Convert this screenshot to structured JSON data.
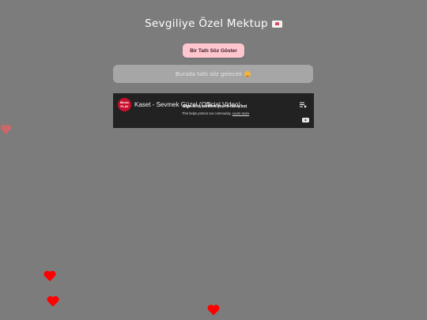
{
  "page": {
    "title": "Sevgiliye Özel Mektup",
    "title_icon": "love-letter-icon"
  },
  "sweet_button": {
    "label": "Bir Tatlı Söz Göster",
    "color": "#ffc6d0"
  },
  "message": {
    "text": "Burada tatlı söz gelecek",
    "icon": "smiling-face-icon"
  },
  "video": {
    "channel_logo_line1": "Music",
    "channel_logo_line2": "PLAY",
    "title": "Kaset - Sevmek Güzel (Official Video)",
    "bot_notice": "Sign in to confirm you're not a bot",
    "bot_sub": "This helps protect our community.",
    "learn_more": "Learn more"
  },
  "colors": {
    "background": "#7c7c7c",
    "heart": "#ff0000",
    "heart_faded": "#c96868"
  }
}
